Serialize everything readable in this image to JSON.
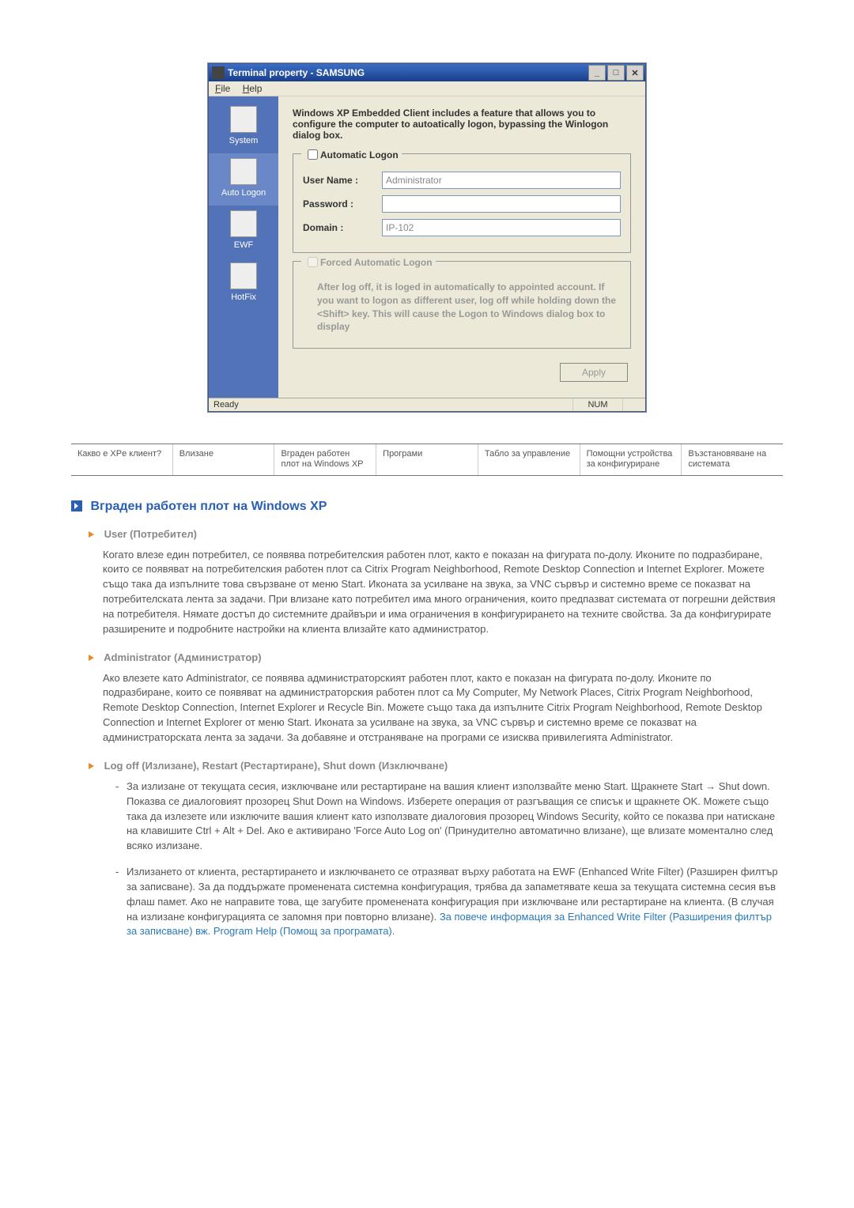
{
  "window": {
    "title": "Terminal property - SAMSUNG",
    "menu": {
      "file": "File",
      "help": "Help"
    },
    "sidebar": {
      "items": [
        {
          "label": "System"
        },
        {
          "label": "Auto Logon"
        },
        {
          "label": "EWF"
        },
        {
          "label": "HotFix"
        }
      ]
    },
    "main": {
      "description": "Windows XP Embedded Client includes a feature that allows you to configure the computer to autoatically logon, bypassing the Winlogon dialog box.",
      "group1": {
        "legend": "Automatic Logon",
        "username_label": "User Name :",
        "username_value": "Administrator",
        "password_label": "Password :",
        "password_value": "",
        "domain_label": "Domain :",
        "domain_value": "IP-102"
      },
      "group2": {
        "legend": "Forced Automatic Logon",
        "text": "After log off, it is loged in automatically to appointed account. If you want to logon as different user, log off while holding down the <Shift> key. This will cause the Logon to Windows dialog box to display"
      },
      "apply": "Apply"
    },
    "status": {
      "ready": "Ready",
      "num": "NUM"
    }
  },
  "nav": {
    "items": [
      "Какво е XPe клиент?",
      "Влизане",
      "Вграден работен плот на Windows XP",
      "Програми",
      "Табло за управление",
      "Помощни устройства за конфигуриране",
      "Възстановяване на системата"
    ]
  },
  "article": {
    "title": "Вграден работен плот на Windows XP",
    "sections": [
      {
        "heading": "User (Потребител)",
        "body": "Когато влезе един потребител, се появява потребителския работен плот, както е показан на фигурата по-долу. Иконите по подразбиране, които се появяват на потребителския работен плот са Citrix Program Neighborhood, Remote Desktop Connection и Internet Explorer. Можете също така да изпълните това свързване от меню Start. Иконата за усилване на звука, за VNC сървър и системно време се показват на потребителската лента за задачи.\nПри влизане като потребител има много ограничения, които предпазват системата от погрешни действия на потребителя. Нямате достъп до системните драйвъри и има ограничения в конфигурирането на техните свойства. За да конфигурирате разширените и подробните настройки на клиента влизайте като администратор."
      },
      {
        "heading": "Administrator (Администратор)",
        "body": "Ако влезете като Administrator, се появява администраторският работен плот, както е показан на фигурата по-долу. Иконите по подразбиране, които се появяват на администраторския работен плот са My Computer, My Network Places, Citrix Program Neighborhood, Remote Desktop Connection, Internet Explorer и Recycle Bin. Можете също така да изпълните Citrix Program Neighborhood, Remote Desktop Connection и Internet Explorer от меню Start. Иконата за усилване на звука, за VNC сървър и системно време се показват на администраторската лента за задачи. За добавяне и отстраняване на програми се изисква привилегията Administrator."
      },
      {
        "heading": "Log off (Излизане), Restart (Рестартиране), Shut down (Изключване)",
        "list": [
          "За излизане от текущата сесия, изключване или рестартиране на вашия клиент използвайте меню Start. Щракнете Start → Shut down. Показва се диалоговият прозорец Shut Down на Windows. Изберете операция от разгъващия се списък и щракнете OK. Можете също така да излезете или изключите вашия клиент като използвате диалоговия прозорец Windows Security, който се показва при натискане на клавишите Ctrl + Alt + Del. Ако е активирано 'Force Auto Log on' (Принудително автоматично влизане), ще влизате моментално след всяко излизане.",
          "Излизането от клиента, рестартирането и изключването се отразяват върху работата на EWF (Enhanced Write Filter) (Разширен филтър за записване). За да поддържате променената системна конфигурация, трябва да запаметявате кеша за текущата системна сесия във флаш памет. Ако не направите това, ще загубите променената конфигурация при изключване или рестартиране на клиента. (В случая на излизане конфигурацията се запомня при повторно влизане). "
        ],
        "link": "За повече информация за Enhanced Write Filter (Разширения филтър за записване) вж. Program Help (Помощ за програмата)."
      }
    ]
  }
}
